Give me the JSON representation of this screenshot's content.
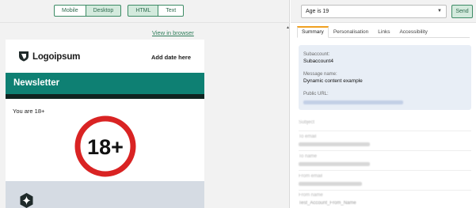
{
  "preview": {
    "modes": [
      "Mobile",
      "Desktop"
    ],
    "active_mode": "Desktop",
    "formats": [
      "HTML",
      "Text"
    ],
    "active_format": "HTML",
    "view_in_browser": "View in browser"
  },
  "email": {
    "logo_text": "Logoipsum",
    "date_placeholder": "Add date here",
    "banner_title": "Newsletter",
    "age_message": "You are 18+",
    "age_badge": "18+",
    "colors": {
      "banner": "#0e8073",
      "banner_dark": "#0f2320",
      "sign_ring": "#d92323",
      "footer": "#d5dbe3"
    }
  },
  "controls": {
    "condition_select": "Age is 19",
    "send_label": "Send"
  },
  "tabs": [
    {
      "label": "Summary",
      "active": true
    },
    {
      "label": "Personalisation",
      "active": false
    },
    {
      "label": "Links",
      "active": false
    },
    {
      "label": "Accessibility",
      "active": false
    }
  ],
  "summary": {
    "subaccount_label": "Subaccount:",
    "subaccount_value": "Subaccount4",
    "message_name_label": "Message name:",
    "message_name_value": "Dynamic content example",
    "public_url_label": "Public URL:",
    "subject_label": "Subject",
    "to_email_label": "To email",
    "to_name_label": "To name",
    "from_email_label": "From email",
    "from_name_label": "From name",
    "from_name_value": "Test_Account_From_Name"
  },
  "icons": {
    "logo": "shield-logo-icon",
    "age_sign": "age-restriction-sign-icon",
    "footer_logo": "sparkle-badge-icon",
    "select_caret": "chevron-down-icon"
  }
}
